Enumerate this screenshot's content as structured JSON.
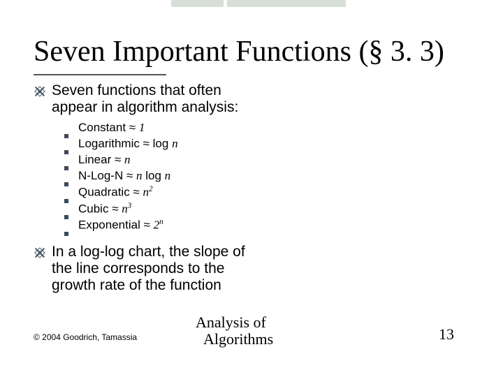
{
  "title": "Seven Important Functions (§ 3. 3)",
  "intro": "Seven functions that often appear in algorithm analysis:",
  "functions": {
    "f0": {
      "name": "Constant",
      "expr": "1"
    },
    "f1": {
      "name": "Logarithmic",
      "expr_prefix": "log ",
      "var": "n"
    },
    "f2": {
      "name": "Linear",
      "var": "n"
    },
    "f3": {
      "name": "N-Log-N",
      "var1": "n",
      "mid": " log ",
      "var2": "n"
    },
    "f4": {
      "name": "Quadratic",
      "var": "n",
      "sup": "2"
    },
    "f5": {
      "name": "Cubic",
      "var": "n",
      "sup": "3"
    },
    "f6": {
      "name": "Exponential",
      "base": "2",
      "sup": "n"
    }
  },
  "note": "In a log-log chart, the slope of the line corresponds to the growth rate of the function",
  "center1": "Analysis of",
  "center2": "Algorithms",
  "pagenum": "13",
  "copyright": "© 2004 Goodrich, Tamassia"
}
